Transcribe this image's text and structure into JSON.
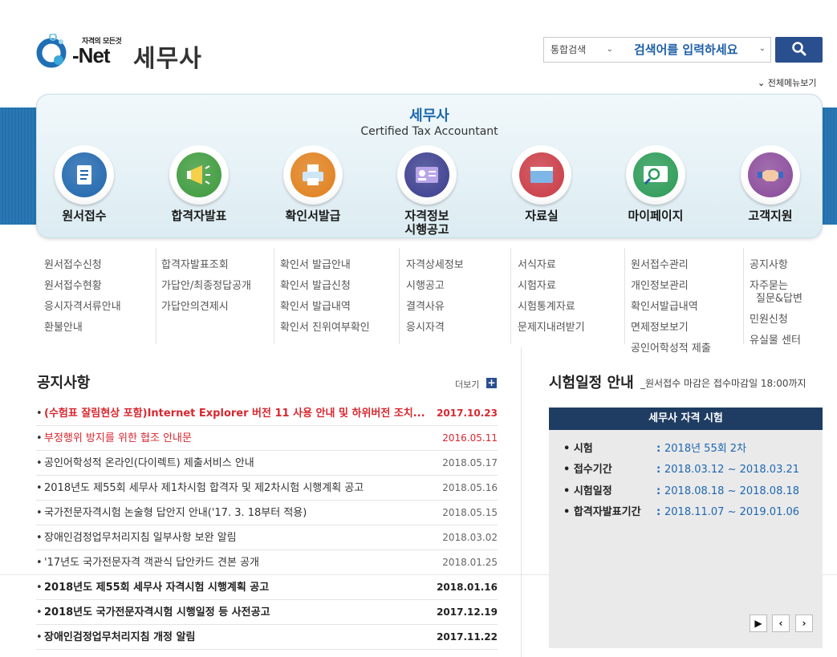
{
  "header": {
    "logo_sub": "자격의 모든것",
    "logo_text": "Net",
    "site_title": "세무사",
    "search_scope": "통합검색",
    "search_placeholder": "검색어를 입력하세요",
    "all_menu": "전체메뉴보기"
  },
  "panel": {
    "title": "세무사",
    "subtitle": "Certified Tax Accountant"
  },
  "menus": [
    {
      "label": "원서접수",
      "icon": "document-icon",
      "color": "#1f66ad",
      "sub": [
        "원서접수신청",
        "원서접수현황",
        "응시자격서류안내",
        "환불안내"
      ]
    },
    {
      "label": "합격자발표",
      "icon": "megaphone-icon",
      "color": "#3c9a3b",
      "sub": [
        "합격자발표조회",
        "가답안/최종정답공개",
        "가답안의견제시"
      ]
    },
    {
      "label": "확인서발급",
      "icon": "printer-icon",
      "color": "#e07f1b",
      "sub": [
        "확인서 발급안내",
        "확인서 발급신청",
        "확인서 발급내역",
        "확인서 진위여부확인"
      ]
    },
    {
      "label": "자격정보\n시행공고",
      "icon": "id-card-icon",
      "color": "#3a3d8e",
      "sub": [
        "자격상세정보",
        "시행공고",
        "결격사유",
        "응시자격"
      ]
    },
    {
      "label": "자료실",
      "icon": "folder-icon",
      "color": "#c93a44",
      "sub": [
        "서식자료",
        "시험자료",
        "시험통계자료",
        "문제지내려받기"
      ]
    },
    {
      "label": "마이페이지",
      "icon": "monitor-search-icon",
      "color": "#2a9a55",
      "sub": [
        "원서접수관리",
        "개인정보관리",
        "확인서발급내역",
        "면제정보보기",
        "공인어학성적 제출"
      ]
    },
    {
      "label": "고객지원",
      "icon": "handshake-icon",
      "color": "#8a4a9a",
      "sub": [
        "공지사항",
        "자주묻는\n질문&답변",
        "민원신청",
        "유실물 센터"
      ]
    }
  ],
  "notices": {
    "title": "공지사항",
    "more": "더보기",
    "items": [
      {
        "title": "(수험표 잘림현상 포함)Internet Explorer 버전 11 사용 안내 및 하위버전 조치...",
        "date": "2017.10.23",
        "style": "redbold"
      },
      {
        "title": "부정행위 방지를 위한 협조 안내문",
        "date": "2016.05.11",
        "style": "red"
      },
      {
        "title": "공인어학성적 온라인(다이렉트) 제출서비스 안내",
        "date": "2018.05.17",
        "style": "normal"
      },
      {
        "title": "2018년도 제55회 세무사 제1차시험 합격자 및 제2차시험 시행계획 공고",
        "date": "2018.05.16",
        "style": "normal"
      },
      {
        "title": "국가전문자격시험 논술형 답안지 안내('17. 3. 18부터 적용)",
        "date": "2018.05.15",
        "style": "normal"
      },
      {
        "title": "장애인검정업무처리지침 일부사항 보완 알림",
        "date": "2018.03.02",
        "style": "normal"
      },
      {
        "title": "'17년도 국가전문자격 객관식 답안카드 견본 공개",
        "date": "2018.01.25",
        "style": "normal"
      },
      {
        "title": "2018년도 제55회 세무사 자격시험 시행계획 공고",
        "date": "2018.01.16",
        "style": "bold"
      },
      {
        "title": "2018년도 국가전문자격시험 시행일정 등 사전공고",
        "date": "2017.12.19",
        "style": "bold"
      },
      {
        "title": "장애인검정업무처리지침 개정 알림",
        "date": "2017.11.22",
        "style": "bold"
      }
    ]
  },
  "schedule": {
    "title": "시험일정 안내",
    "note": "_원서접수 마감은 접수마감일 18:00까지",
    "box_title": "세무사 자격 시험",
    "rows": [
      {
        "key": "• 시험",
        "value": "2018년 55회 2차"
      },
      {
        "key": "• 접수기간",
        "value": "2018.03.12 ~ 2018.03.21"
      },
      {
        "key": "• 시험일정",
        "value": "2018.08.18 ~ 2018.08.18"
      },
      {
        "key": "• 합격자발표기간",
        "value": "2018.11.07 ~ 2019.01.06"
      }
    ],
    "colon": ":"
  }
}
